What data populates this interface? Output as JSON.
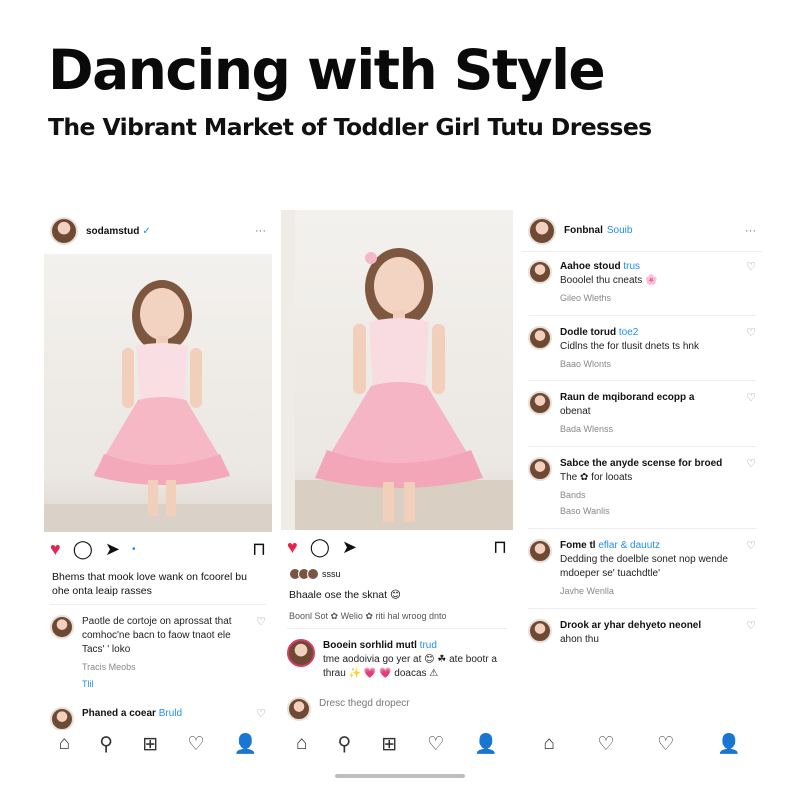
{
  "headline": {
    "title": "Dancing with Style",
    "subtitle": "The Vibrant Market of Toddler Girl Tutu Dresses"
  },
  "panel1": {
    "username": "sodamstud",
    "verified_icon": "✓",
    "menu": "···",
    "caption": "Bhems that mook love wank on fcoorel bu ohe onta leaip rasses",
    "comments": [
      {
        "text": "Paotle de cortoje on aprossat that comhoc'ne bacn to faow tnaot ele Tacs' ' loko",
        "meta": "Tracis Meobs",
        "sub": "Tlil"
      },
      {
        "user": "Phaned a coear",
        "tag": "Bruld",
        "text": ""
      }
    ]
  },
  "panel2": {
    "pager": "•",
    "likes": "sssu",
    "caption": "Bhaale ose the sknat 😊",
    "caption2": "Boonl Sot   ✿   Welio   ✿   riti hal wroog dnto",
    "comments": [
      {
        "user": "Booein sorhlid mutl",
        "tag": "trud",
        "text": "tme aodoivia go yer at 😊 ☘ ate bootr a thrau ✨ 💗 💗 doacas ⚠"
      },
      {
        "text": "Dresc thegd dropecr"
      }
    ]
  },
  "panel3": {
    "username": "Fonbnal",
    "tag": "Souib",
    "menu": "···",
    "comments": [
      {
        "user": "Aahoe stoud",
        "tag": "trus",
        "text": "Booolel thu cneats 🌸",
        "meta": "Gileo Wleths"
      },
      {
        "user": "Dodle torud",
        "tag": "toe2",
        "text": "Cidlns the for tlusit dnets ts hnk",
        "meta": "Baao Wlonts"
      },
      {
        "user": "Raun de mqiborand ecopp a",
        "text": "obenat",
        "meta": "Bada Wlenss"
      },
      {
        "user": "Sabce the anyde scense for broed",
        "text": "The ✿ for looats",
        "meta": "Bands",
        "meta2": "Baso Wanlis"
      },
      {
        "user": "Fome tl",
        "tag": "eflar & dauutz",
        "text": "Dedding the doelble sonet nop wende mdoeper se' tuachdtle'",
        "meta": "Javhe Wenlla"
      },
      {
        "user": "Drook ar yhar dehyeto neonel",
        "text": "ahon thu"
      }
    ]
  },
  "icons": {
    "heart": "♥",
    "heart_outline": "♡",
    "comment": "◯",
    "share": "➤",
    "bookmark": "⊓",
    "home": "⌂",
    "search": "⚲",
    "add": "⊞",
    "profile": "👤"
  }
}
